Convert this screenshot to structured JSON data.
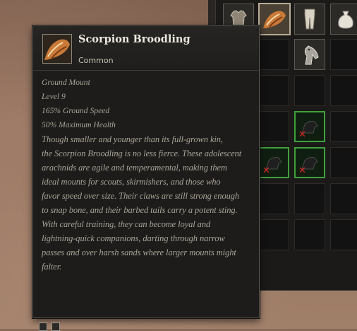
{
  "tooltip": {
    "name": "Scorpion Broodling",
    "rarity": "Common",
    "icon": "scorpion-broodling-icon",
    "type_line": "Ground Mount",
    "level_line": "Level 9",
    "stats": [
      "165% Ground Speed",
      "50% Maximum Health"
    ],
    "description": [
      "Though smaller and younger than its full-grown kin,",
      "the Scorpion Broodling is no less fierce. These adolescent",
      "arachnids are agile and temperamental, making them",
      "ideal mounts for scouts, skirmishers, and those who",
      "favor speed over size. Their claws are still strong enough",
      "to snap bone, and their barbed tails carry a potent sting.",
      "With careful training, they can become loyal and",
      "lightning-quick companions, darting through narrow",
      "passes and over harsh sands where larger mounts might",
      "falter."
    ]
  },
  "inventory": {
    "slots": [
      {
        "icon": "armor-shirt-icon"
      },
      {
        "icon": "scorpion-mount-icon",
        "selected": true
      },
      {
        "icon": "leg-armor-icon"
      },
      {
        "icon": "bag-icon"
      },
      {
        "icon": "horse-mount-icon"
      },
      {
        "icon": "dark-mount-icon",
        "locked": true
      },
      {
        "icon": "dark-mount-icon",
        "locked": true
      },
      {
        "icon": "dark-mount-icon",
        "locked": true
      }
    ],
    "locked_mark": "✕"
  },
  "colors": {
    "accent_green": "#3fa03a",
    "lock_red": "#e02424",
    "title_text": "#ece7dd",
    "body_text": "#a9a396"
  }
}
